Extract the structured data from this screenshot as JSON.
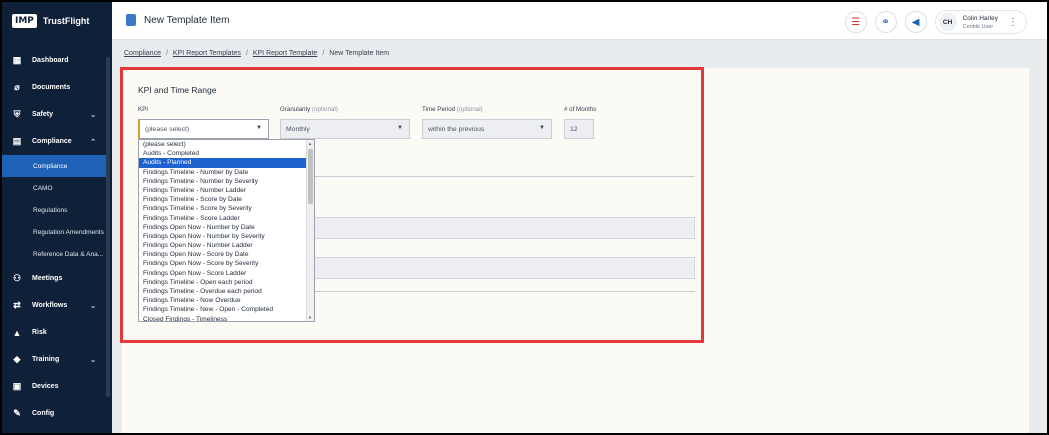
{
  "app": {
    "logo_abbr": "IMP",
    "logo_name": "TrustFlight"
  },
  "sidebar": {
    "items": [
      {
        "label": "Dashboard",
        "icon": "dashboard-icon"
      },
      {
        "label": "Documents",
        "icon": "paperclip-icon"
      },
      {
        "label": "Safety",
        "icon": "shield-icon",
        "chevron": "down"
      },
      {
        "label": "Compliance",
        "icon": "compliance-icon",
        "chevron": "up"
      },
      {
        "label": "Meetings",
        "icon": "meetings-icon"
      },
      {
        "label": "Workflows",
        "icon": "workflow-icon",
        "chevron": "down"
      },
      {
        "label": "Risk",
        "icon": "warning-icon"
      },
      {
        "label": "Training",
        "icon": "graduation-cap-icon",
        "chevron": "down"
      },
      {
        "label": "Devices",
        "icon": "devices-icon"
      },
      {
        "label": "Config",
        "icon": "config-icon"
      }
    ],
    "compliance_sub": [
      "Compliance",
      "CAMO",
      "Regulations",
      "Regulation Amendments",
      "Reference Data & Ana..."
    ]
  },
  "topbar": {
    "title": "New Template Item",
    "user_initials": "CH",
    "user_name": "Colin Harley",
    "user_role": "Centrik User"
  },
  "breadcrumb": [
    "Compliance",
    "KPI Report Templates",
    "KPI Report Template",
    "New Template Item"
  ],
  "form": {
    "section_title": "KPI and Time Range",
    "kpi_label": "KPI",
    "kpi_value": "(please select)",
    "granularity_label": "Granularity",
    "granularity_optional": "(optional)",
    "granularity_value": "Monthly",
    "time_period_label": "Time Period",
    "time_period_optional": "(optional)",
    "time_period_value": "within the previous",
    "months_label": "# of Months",
    "months_value": "12"
  },
  "kpi_options": [
    "(please select)",
    "Audits - Completed",
    "Audits - Planned",
    "Findings Timeline - Number by Date",
    "Findings Timeline - Number by Severity",
    "Findings Timeline - Number Ladder",
    "Findings Timeline - Score by Date",
    "Findings Timeline - Score by Severity",
    "Findings Timeline - Score Ladder",
    "Findings Open Now - Number by Date",
    "Findings Open Now - Number by Severity",
    "Findings Open Now - Number Ladder",
    "Findings Open Now - Score by Date",
    "Findings Open Now - Score by Severity",
    "Findings Open Now - Score Ladder",
    "Findings Timeline - Open each period",
    "Findings Timeline - Overdue each period",
    "Findings Timeline - Now Overdue",
    "Findings Timeline - New - Open - Completed",
    "Closed Findings - Timeliness"
  ],
  "kpi_highlighted_index": 2,
  "colors": {
    "sidebar_bg": "#0f2139",
    "accent": "#1e62b8",
    "highlight_border": "#e5383b"
  }
}
